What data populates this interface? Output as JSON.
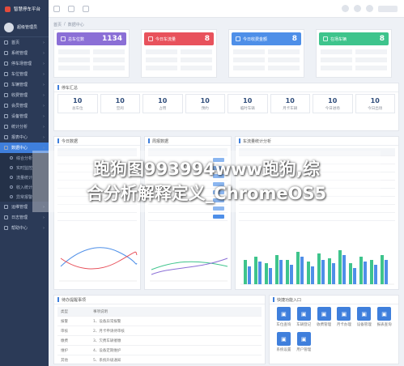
{
  "app": {
    "title": "智慧停车平台"
  },
  "profile": {
    "name": "超级管理员"
  },
  "sidebar": {
    "items": [
      {
        "label": "首页",
        "icon": "home-icon"
      },
      {
        "label": "系统管理",
        "icon": "gear-icon"
      },
      {
        "label": "停车场管理",
        "icon": "parking-icon"
      },
      {
        "label": "车位管理",
        "icon": "grid-icon"
      },
      {
        "label": "车辆管理",
        "icon": "car-icon"
      },
      {
        "label": "收费管理",
        "icon": "coin-icon"
      },
      {
        "label": "会员管理",
        "icon": "user-icon"
      },
      {
        "label": "设备管理",
        "icon": "device-icon"
      },
      {
        "label": "统计分析",
        "icon": "chart-icon"
      },
      {
        "label": "报表中心",
        "icon": "report-icon"
      }
    ],
    "active_label": "数据中心",
    "sub_items": [
      "综合分析",
      "实时监控",
      "流量统计",
      "收入统计",
      "异常报警"
    ],
    "bottom_items": [
      "运维管理",
      "日志管理",
      "帮助中心"
    ]
  },
  "breadcrumb": [
    "首页",
    "数据中心"
  ],
  "stats": [
    {
      "label": "总车位数",
      "value": "1134",
      "color": "#8b6fd6",
      "icon": "parking-icon"
    },
    {
      "label": "今日车流量",
      "value": "8",
      "color": "#e8525c",
      "icon": "shield-icon"
    },
    {
      "label": "今日收费金额",
      "value": "8",
      "color": "#4e8fe8",
      "icon": "flag-icon"
    },
    {
      "label": "在场车辆",
      "value": "8",
      "color": "#3ec48c",
      "icon": "car-icon"
    }
  ],
  "summary": {
    "title": "停车汇总",
    "cells": [
      {
        "value": "10",
        "label": "总车位"
      },
      {
        "value": "10",
        "label": "空闲"
      },
      {
        "value": "10",
        "label": "占用"
      },
      {
        "value": "10",
        "label": "预约"
      },
      {
        "value": "10",
        "label": "临时车辆"
      },
      {
        "value": "10",
        "label": "月卡车辆"
      },
      {
        "value": "10",
        "label": "今日进场"
      },
      {
        "value": "10",
        "label": "今日出场"
      }
    ]
  },
  "panels": {
    "today": {
      "title": "今日数据"
    },
    "weekly": {
      "title": "周报数据"
    },
    "analysis": {
      "title": "车流量统计分析"
    },
    "todo": {
      "title": "待办提醒事项"
    },
    "quick": {
      "title": "快捷功能入口"
    }
  },
  "todo_rows": [
    {
      "c1": "类型",
      "c2": "事项说明"
    },
    {
      "c1": "报警",
      "c2": "1、设备异常报警"
    },
    {
      "c1": "审核",
      "c2": "2、月卡申请待审核"
    },
    {
      "c1": "缴费",
      "c2": "3、欠费车辆催缴"
    },
    {
      "c1": "维护",
      "c2": "4、设备定期维护"
    },
    {
      "c1": "其他",
      "c2": "5、系统升级通知"
    }
  ],
  "quick": [
    "车位查询",
    "车辆登记",
    "收费管理",
    "月卡办理",
    "设备管理",
    "报表查询",
    "系统设置",
    "用户管理"
  ],
  "watermark": {
    "line1": "跑狗图993994www跑狗,综",
    "line2": "合分析解释定义_ChromeOS5"
  },
  "colors": {
    "accent": "#3f7fdc",
    "sidebar": "#2b3a57",
    "series_a": "#3ec48c",
    "series_b": "#4e8fe8"
  }
}
